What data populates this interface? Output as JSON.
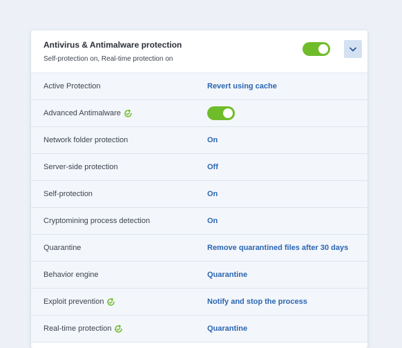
{
  "section": {
    "title": "Antivirus & Antimalware protection",
    "subtitle": "Self-protection on, Real-time protection on",
    "enabled": true
  },
  "colors": {
    "toggle_on": "#6fbc2b",
    "link": "#2b66b0",
    "badge": "#6fbc2b",
    "expand_button_bg": "#d3e1f2"
  },
  "settings": [
    {
      "label": "Active Protection",
      "value": "Revert using cache"
    },
    {
      "label": "Advanced Antimalware",
      "badge": "sync-check-icon",
      "toggle": true
    },
    {
      "label": "Network folder protection",
      "value": "On"
    },
    {
      "label": "Server-side protection",
      "value": "Off"
    },
    {
      "label": "Self-protection",
      "value": "On"
    },
    {
      "label": "Cryptomining process detection",
      "value": "On"
    },
    {
      "label": "Quarantine",
      "value": "Remove quarantined files after 30 days"
    },
    {
      "label": "Behavior engine",
      "value": "Quarantine"
    },
    {
      "label": "Exploit prevention",
      "badge": "sync-check-icon",
      "value": "Notify and stop the process"
    },
    {
      "label": "Real-time protection",
      "badge": "sync-check-icon",
      "value": "Quarantine"
    }
  ]
}
